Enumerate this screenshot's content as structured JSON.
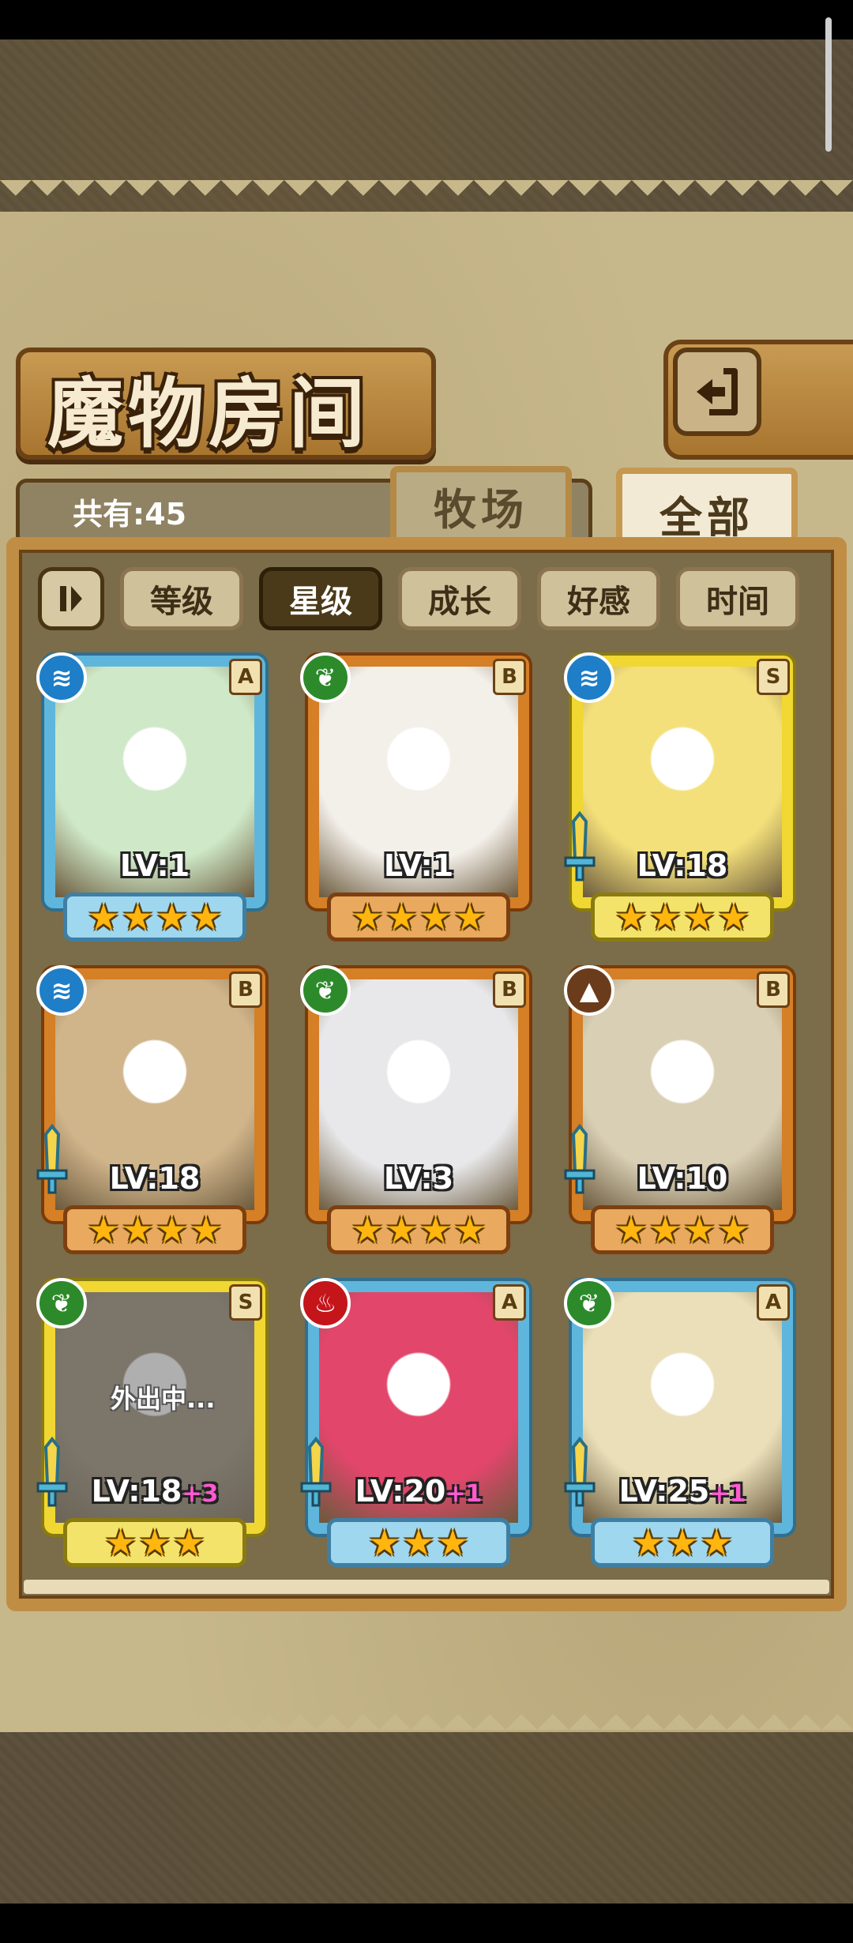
{
  "header": {
    "title": "魔物房间"
  },
  "summary": {
    "total_label": "共有:45"
  },
  "tabs": [
    {
      "label": "牧场",
      "active": false
    },
    {
      "label": "全部",
      "active": true
    }
  ],
  "sort_options": [
    {
      "label": "等级",
      "active": false
    },
    {
      "label": "星级",
      "active": true
    },
    {
      "label": "成长",
      "active": false
    },
    {
      "label": "好感",
      "active": false
    },
    {
      "label": "时间",
      "active": false
    }
  ],
  "monsters": [
    {
      "rank": "A",
      "element": "water",
      "lv": "LV:1",
      "plus": "",
      "stars": 4,
      "weapon": false,
      "outing": "",
      "color": "#cfe9c8"
    },
    {
      "rank": "B",
      "element": "grass",
      "lv": "LV:1",
      "plus": "",
      "stars": 4,
      "weapon": false,
      "outing": "",
      "color": "#f3efe9"
    },
    {
      "rank": "S",
      "element": "water",
      "lv": "LV:18",
      "plus": "",
      "stars": 4,
      "weapon": true,
      "outing": "",
      "color": "#f4e07a"
    },
    {
      "rank": "B",
      "element": "water",
      "lv": "LV:18",
      "plus": "",
      "stars": 4,
      "weapon": true,
      "outing": "",
      "color": "#d0b48a"
    },
    {
      "rank": "B",
      "element": "grass",
      "lv": "LV:3",
      "plus": "",
      "stars": 4,
      "weapon": false,
      "outing": "",
      "color": "#e8e8ea"
    },
    {
      "rank": "B",
      "element": "earth",
      "lv": "LV:10",
      "plus": "",
      "stars": 4,
      "weapon": true,
      "outing": "",
      "color": "#d9cfb4"
    },
    {
      "rank": "S",
      "element": "grass",
      "lv": "LV:18",
      "plus": "+3",
      "stars": 3,
      "weapon": true,
      "outing": "外出中...",
      "color": "#8c7f66"
    },
    {
      "rank": "A",
      "element": "fire",
      "lv": "LV:20",
      "plus": "+1",
      "stars": 3,
      "weapon": true,
      "outing": "",
      "color": "#e2466b"
    },
    {
      "rank": "A",
      "element": "grass",
      "lv": "LV:25",
      "plus": "+1",
      "stars": 3,
      "weapon": true,
      "outing": "",
      "color": "#eadfb9"
    }
  ],
  "colors": {
    "panel": "#c7b88c",
    "frame": "#c08d45",
    "accent_pink": "#ff5ad0"
  }
}
